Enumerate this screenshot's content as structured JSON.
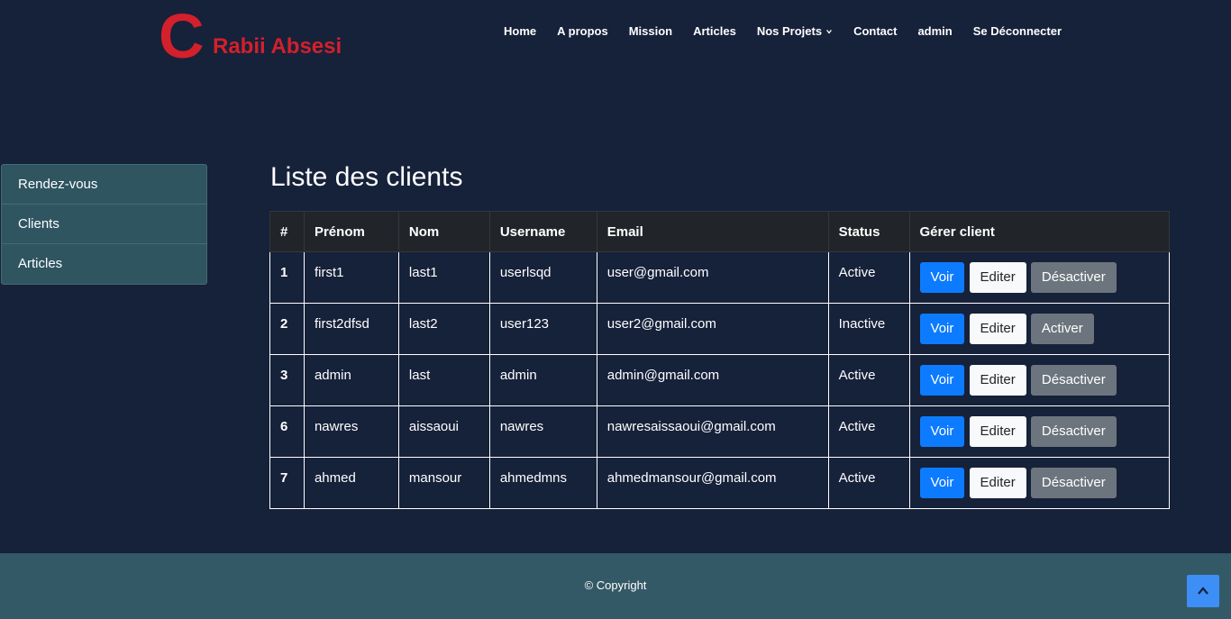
{
  "brand": {
    "letter": "C",
    "name": "Rabii Absesi",
    "color": "#d3202b"
  },
  "nav": {
    "items": [
      "Home",
      "A propos",
      "Mission",
      "Articles",
      "Nos Projets",
      "Contact",
      "admin",
      "Se Déconnecter"
    ]
  },
  "sidebar": {
    "items": [
      {
        "label": "Rendez-vous"
      },
      {
        "label": "Clients"
      },
      {
        "label": "Articles"
      }
    ]
  },
  "main": {
    "title": "Liste des clients",
    "table": {
      "headers": [
        "#",
        "Prénom",
        "Nom",
        "Username",
        "Email",
        "Status",
        "Gérer client"
      ],
      "rows": [
        {
          "id": "1",
          "prenom": "first1",
          "nom": "last1",
          "username": "userlsqd",
          "email": "user@gmail.com",
          "status": "Active",
          "voir": "Voir",
          "editer": "Editer",
          "toggle": "Désactiver"
        },
        {
          "id": "2",
          "prenom": "first2dfsd",
          "nom": "last2",
          "username": "user123",
          "email": "user2@gmail.com",
          "status": "Inactive",
          "voir": "Voir",
          "editer": "Editer",
          "toggle": "Activer"
        },
        {
          "id": "3",
          "prenom": "admin",
          "nom": "last",
          "username": "admin",
          "email": "admin@gmail.com",
          "status": "Active",
          "voir": "Voir",
          "editer": "Editer",
          "toggle": "Désactiver"
        },
        {
          "id": "6",
          "prenom": "nawres",
          "nom": "aissaoui",
          "username": "nawres",
          "email": "nawresaissaoui@gmail.com",
          "status": "Active",
          "voir": "Voir",
          "editer": "Editer",
          "toggle": "Désactiver"
        },
        {
          "id": "7",
          "prenom": "ahmed",
          "nom": "mansour",
          "username": "ahmedmns",
          "email": "ahmedmansour@gmail.com",
          "status": "Active",
          "voir": "Voir",
          "editer": "Editer",
          "toggle": "Désactiver"
        }
      ]
    }
  },
  "footer": {
    "copyright": "© Copyright"
  },
  "icons": {
    "dropdown": "chevron-down-icon",
    "back_to_top": "chevron-up-icon"
  },
  "colors": {
    "background": "#16213a",
    "accent_blue": "#0d7bff",
    "footer": "#345966",
    "sidebar": "#2f5561"
  }
}
